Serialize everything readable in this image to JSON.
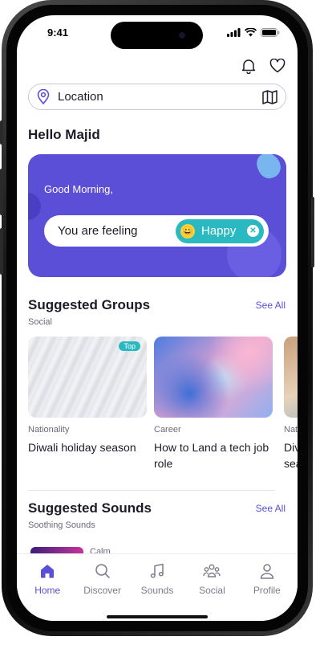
{
  "status_bar": {
    "time": "9:41"
  },
  "location": {
    "placeholder": "Location",
    "icon": "location-pin-icon",
    "map_icon": "map-icon"
  },
  "greeting": {
    "name": "Hello Majid"
  },
  "mood_card": {
    "greeting": "Good Morning,",
    "feeling_label": "You are feeling",
    "mood": "Happy",
    "mood_emoji": "😀",
    "accent": "#5a4fd6",
    "chip_color": "#2bb9c1"
  },
  "suggested_groups": {
    "title": "Suggested Groups",
    "subtitle": "Social",
    "see_all": "See All",
    "items": [
      {
        "badge": "Top",
        "category": "Nationality",
        "title": "Diwali holiday season"
      },
      {
        "badge": "",
        "category": "Career",
        "title": "How to Land a tech job role"
      },
      {
        "badge": "",
        "category": "Nat",
        "title": "Div sea"
      }
    ]
  },
  "suggested_sounds": {
    "title": "Suggested Sounds",
    "subtitle": "Soothing Sounds",
    "see_all": "See All",
    "items": [
      {
        "name": "Calm"
      }
    ]
  },
  "tabs": [
    {
      "label": "Home",
      "icon": "home-icon",
      "active": true
    },
    {
      "label": "Discover",
      "icon": "search-icon",
      "active": false
    },
    {
      "label": "Sounds",
      "icon": "music-note-icon",
      "active": false
    },
    {
      "label": "Social",
      "icon": "people-icon",
      "active": false
    },
    {
      "label": "Profile",
      "icon": "user-icon",
      "active": false
    }
  ]
}
